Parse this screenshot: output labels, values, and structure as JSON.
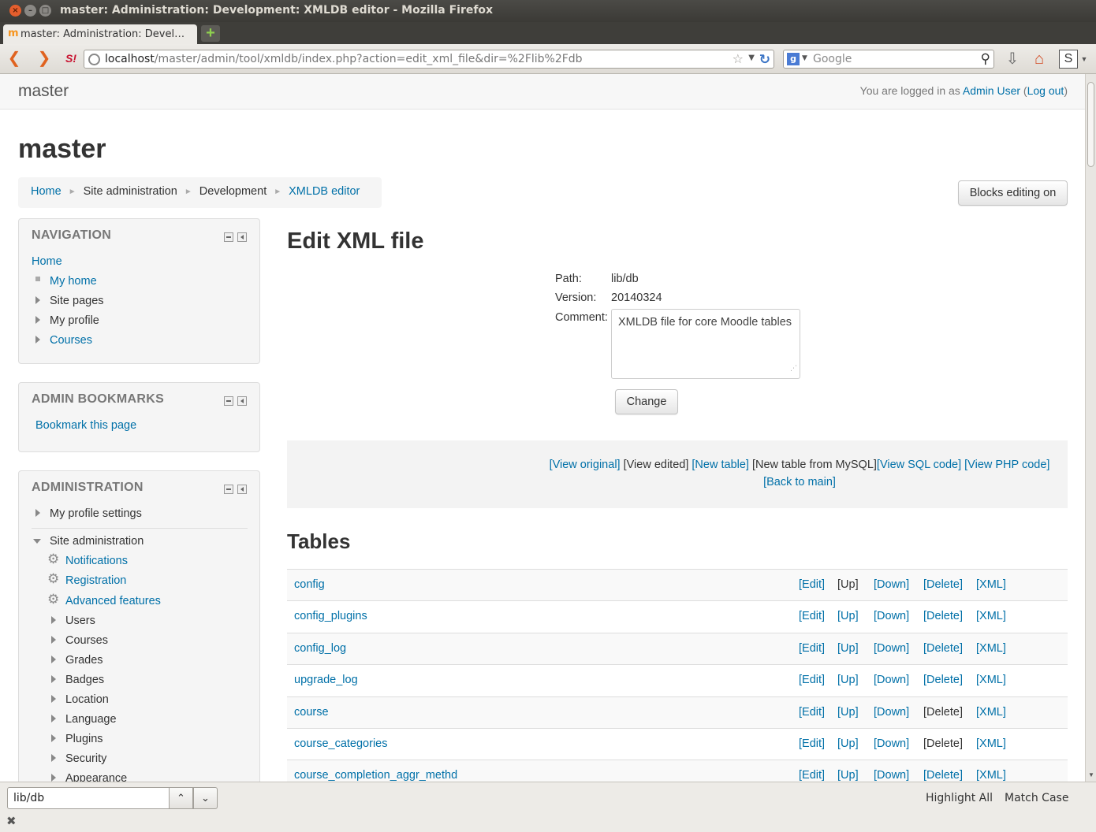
{
  "window": {
    "title": "master: Administration: Development: XMLDB editor - Mozilla Firefox",
    "tab_title": "master: Administration: Devel…",
    "close_glyph": "×",
    "min_glyph": "–",
    "max_glyph": "□",
    "newtab_glyph": "+"
  },
  "browser": {
    "url_host": "localhost",
    "url_path": "/master/admin/tool/xmldb/index.php?action=edit_xml_file&dir=%2Flib%2Fdb",
    "search_placeholder": "Google",
    "icons": [
      "back-icon",
      "forward-icon",
      "stumbleupon-icon",
      "globe-icon",
      "bookmark-star-icon",
      "reload-icon",
      "google-icon",
      "search-icon",
      "downloads-icon",
      "home-icon",
      "addon-icon"
    ]
  },
  "site": {
    "brand": "master",
    "login_prefix": "You are logged in as ",
    "login_user": "Admin User",
    "login_open": " (",
    "logout": "Log out",
    "login_close": ")",
    "heading": "master"
  },
  "breadcrumb": {
    "items": [
      "Home",
      "Site administration",
      "Development",
      "XMLDB editor"
    ],
    "sep": "►"
  },
  "blocks_editing_button": "Blocks editing on",
  "navigation": {
    "title": "NAVIGATION",
    "home": "Home",
    "items": [
      "My home",
      "Site pages",
      "My profile",
      "Courses"
    ]
  },
  "admin_bookmarks": {
    "title": "ADMIN BOOKMARKS",
    "link": "Bookmark this page"
  },
  "administration": {
    "title": "ADMINISTRATION",
    "my_profile_settings": "My profile settings",
    "site_admin": "Site administration",
    "gear_items": [
      "Notifications",
      "Registration",
      "Advanced features"
    ],
    "folder_items": [
      "Users",
      "Courses",
      "Grades",
      "Badges",
      "Location",
      "Language",
      "Plugins",
      "Security",
      "Appearance"
    ]
  },
  "main": {
    "title": "Edit XML file",
    "path_label": "Path:",
    "path_value": "lib/db",
    "version_label": "Version:",
    "version_value": "20140324",
    "comment_label": "Comment:",
    "comment_value": "XMLDB file for core Moodle tables",
    "change_button": "Change",
    "menu": {
      "view_original": "[View original]",
      "view_edited": "[View edited]",
      "new_table": "[New table]",
      "new_table_mysql": "[New table from MySQL]",
      "view_sql": "[View SQL code]",
      "view_php": "[View PHP code]",
      "back_main": "[Back to main]"
    },
    "tables_heading": "Tables",
    "actions": {
      "edit": "[Edit]",
      "up": "[Up]",
      "down": "[Down]",
      "delete": "[Delete]",
      "xml": "[XML]"
    },
    "tables": [
      {
        "name": "config",
        "up_link": false,
        "delete_link": true
      },
      {
        "name": "config_plugins",
        "up_link": true,
        "delete_link": true
      },
      {
        "name": "config_log",
        "up_link": true,
        "delete_link": true
      },
      {
        "name": "upgrade_log",
        "up_link": true,
        "delete_link": true
      },
      {
        "name": "course",
        "up_link": true,
        "delete_link": false
      },
      {
        "name": "course_categories",
        "up_link": true,
        "delete_link": false
      },
      {
        "name": "course_completion_aggr_methd",
        "up_link": true,
        "delete_link": true
      }
    ]
  },
  "findbar": {
    "value": "lib/db",
    "up_glyph": "⌃",
    "down_glyph": "⌄",
    "highlight_all": "Highlight All",
    "match_case": "Match Case",
    "close_glyph": "✖"
  }
}
